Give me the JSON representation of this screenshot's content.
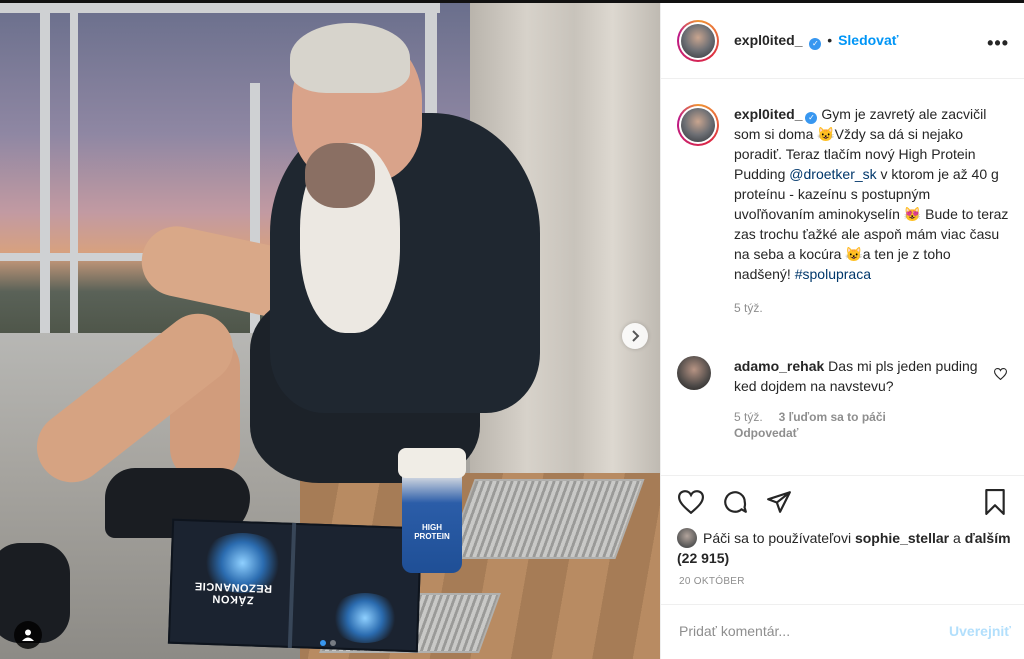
{
  "post": {
    "username": "expl0ited_",
    "follow_label": "Sledovať",
    "separator": "•",
    "caption": "Gym je zavretý ale zacvičil som si doma 😺Vždy sa dá si nejako poradiť. Teraz tlačím nový High Protein Pudding ",
    "caption_mention": "@droetker_sk",
    "caption_mid": " v ktorom je až 40 g proteínu - kazeínu s postupným uvoľňovaním aminokyselín 😻 Bude to teraz zas trochu ťažké ale aspoň mám viac času na seba a kocúra 😺a ten je z toho nadšený! ",
    "caption_hashtag": "#spolupraca",
    "caption_time": "5 týž."
  },
  "comment": {
    "username": "adamo_rehak",
    "text": "Das mi pls jeden puding ked dojdem na navstevu?",
    "time": "5 týž.",
    "likes": "3 ľuďom sa to páči",
    "reply": "Odpovedať"
  },
  "likes": {
    "prefix": "Páči sa to používateľovi ",
    "user": "sophie_stellar",
    "suffix": " a ",
    "others": "ďalším (22 915)"
  },
  "date": "20 OKTÓBER",
  "add_comment": {
    "placeholder": "Pridať komentár...",
    "post_label": "Uverejniť"
  },
  "photo": {
    "book_title": "ZÁKON REZONANCIE",
    "cup_text": "HIGH PROTEIN"
  },
  "icons": {
    "more": "more-options-icon",
    "like": "heart-icon",
    "comment": "comment-icon",
    "share": "share-icon",
    "save": "bookmark-icon",
    "next": "chevron-right-icon",
    "tag": "user-tag-icon"
  },
  "colors": {
    "accent": "#0095f6",
    "verified": "#3897f0",
    "muted": "#8e8e8e"
  }
}
